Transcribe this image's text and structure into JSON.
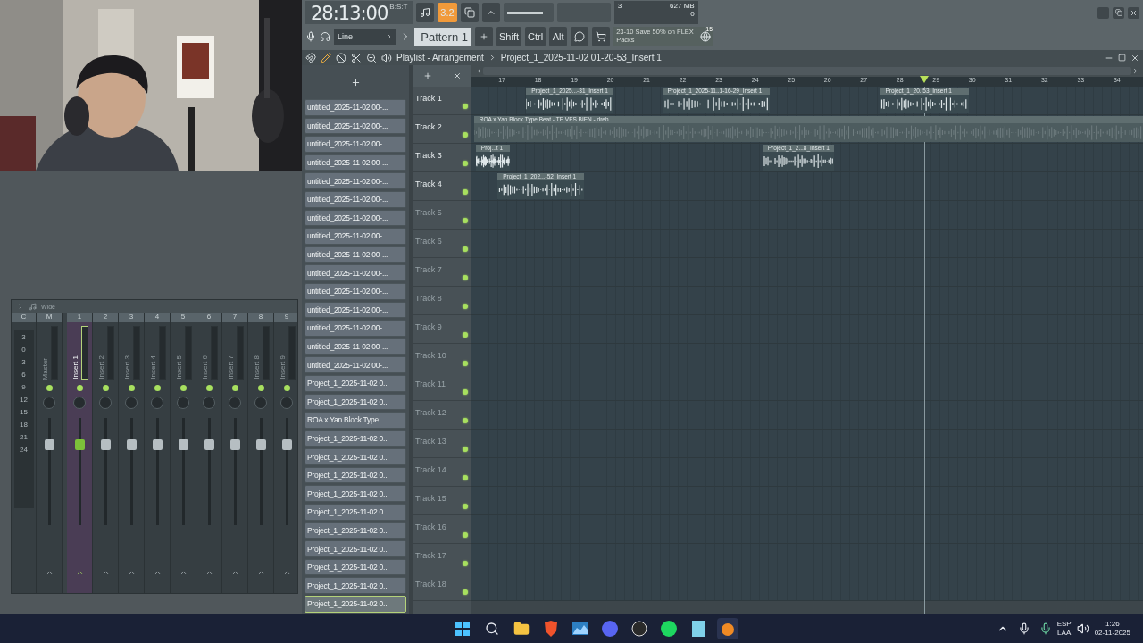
{
  "toolbar": {
    "time": "28:13:00",
    "time_format": "B:S:T",
    "snap": "3.2",
    "main_volume": {
      "level": 0.85
    },
    "cpu": "3",
    "memory": "627 MB",
    "polyphony": "0",
    "input": "Line",
    "pattern": "Pattern 1",
    "modifier_keys": [
      "Shift",
      "Ctrl",
      "Alt"
    ],
    "news": {
      "date": "23-10",
      "text": "Save 50% on FLEX Packs",
      "badge": "15"
    }
  },
  "playlist": {
    "title": "Playlist - Arrangement",
    "project": "Project_1_2025-11-02 01-20-53_Insert 1",
    "bars": [
      "17",
      "18",
      "19",
      "20",
      "21",
      "22",
      "23",
      "24",
      "25",
      "26",
      "27",
      "28",
      "29",
      "30",
      "31",
      "32",
      "33",
      "34"
    ],
    "clips": [
      {
        "label": "untitled_2025-11-02 00-...",
        "selected": false
      },
      {
        "label": "untitled_2025-11-02 00-...",
        "selected": false
      },
      {
        "label": "untitled_2025-11-02 00-...",
        "selected": false
      },
      {
        "label": "untitled_2025-11-02 00-...",
        "selected": false
      },
      {
        "label": "untitled_2025-11-02 00-...",
        "selected": false
      },
      {
        "label": "untitled_2025-11-02 00-...",
        "selected": false
      },
      {
        "label": "untitled_2025-11-02 00-...",
        "selected": false
      },
      {
        "label": "untitled_2025-11-02 00-...",
        "selected": false
      },
      {
        "label": "untitled_2025-11-02 00-...",
        "selected": false
      },
      {
        "label": "untitled_2025-11-02 00-...",
        "selected": false
      },
      {
        "label": "untitled_2025-11-02 00-...",
        "selected": false
      },
      {
        "label": "untitled_2025-11-02 00-...",
        "selected": false
      },
      {
        "label": "untitled_2025-11-02 00-...",
        "selected": false
      },
      {
        "label": "untitled_2025-11-02 00-...",
        "selected": false
      },
      {
        "label": "untitled_2025-11-02 00-...",
        "selected": false
      },
      {
        "label": "Project_1_2025-11-02 0...",
        "selected": false
      },
      {
        "label": "Project_1_2025-11-02 0...",
        "selected": false
      },
      {
        "label": "ROA x Yan Block Type..",
        "selected": false
      },
      {
        "label": "Project_1_2025-11-02 0...",
        "selected": false
      },
      {
        "label": "Project_1_2025-11-02 0...",
        "selected": false
      },
      {
        "label": "Project_1_2025-11-02 0...",
        "selected": false
      },
      {
        "label": "Project_1_2025-11-02 0...",
        "selected": false
      },
      {
        "label": "Project_1_2025-11-02 0...",
        "selected": false
      },
      {
        "label": "Project_1_2025-11-02 0...",
        "selected": false
      },
      {
        "label": "Project_1_2025-11-02 0...",
        "selected": false
      },
      {
        "label": "Project_1_2025-11-02 0...",
        "selected": false
      },
      {
        "label": "Project_1_2025-11-02 0...",
        "selected": false
      },
      {
        "label": "Project_1_2025-11-02 0...",
        "selected": true
      }
    ],
    "tracks": [
      {
        "name": "Track 1",
        "active": true,
        "clips": [
          {
            "label": "Project_1_2025...-31_Insert 1"
          },
          {
            "label": "Project_1_2025-11..1-16-29_Insert 1"
          },
          {
            "label": "Project_1_20..53_Insert 1"
          }
        ]
      },
      {
        "name": "Track 2",
        "active": true,
        "clips": [
          {
            "label": "ROA x Yan Block Type Beat - TE VES BIEN - dreh"
          }
        ]
      },
      {
        "name": "Track 3",
        "active": true,
        "clips": [
          {
            "label": "Proj...t 1"
          },
          {
            "label": "Project_1_2...8_Insert 1"
          }
        ]
      },
      {
        "name": "Track 4",
        "active": true,
        "clips": [
          {
            "label": "Project_1_202...-52_Insert 1"
          }
        ]
      },
      {
        "name": "Track 5",
        "active": false
      },
      {
        "name": "Track 6",
        "active": false
      },
      {
        "name": "Track 7",
        "active": false
      },
      {
        "name": "Track 8",
        "active": false
      },
      {
        "name": "Track 9",
        "active": false
      },
      {
        "name": "Track 10",
        "active": false
      },
      {
        "name": "Track 11",
        "active": false
      },
      {
        "name": "Track 12",
        "active": false
      },
      {
        "name": "Track 13",
        "active": false
      },
      {
        "name": "Track 14",
        "active": false
      },
      {
        "name": "Track 15",
        "active": false
      },
      {
        "name": "Track 16",
        "active": false
      },
      {
        "name": "Track 17",
        "active": false
      },
      {
        "name": "Track 18",
        "active": false
      }
    ]
  },
  "mixer": {
    "mode": "Wide",
    "scale": [
      "3",
      "0",
      "3",
      "6",
      "9",
      "12",
      "15",
      "18",
      "21",
      "24"
    ],
    "strips": [
      {
        "header": "M",
        "name": "Master",
        "selected": false,
        "level": 0.78
      },
      {
        "header": "1",
        "name": "Insert 1",
        "selected": true,
        "level": 0.78
      },
      {
        "header": "2",
        "name": "Insert 2",
        "selected": false,
        "level": 0.78
      },
      {
        "header": "3",
        "name": "Insert 3",
        "selected": false,
        "level": 0.78
      },
      {
        "header": "4",
        "name": "Insert 4",
        "selected": false,
        "level": 0.78
      },
      {
        "header": "5",
        "name": "Insert 5",
        "selected": false,
        "level": 0.78
      },
      {
        "header": "6",
        "name": "Insert 6",
        "selected": false,
        "level": 0.78
      },
      {
        "header": "7",
        "name": "Insert 7",
        "selected": false,
        "level": 0.78
      },
      {
        "header": "8",
        "name": "Insert 8",
        "selected": false,
        "level": 0.78
      },
      {
        "header": "9",
        "name": "Insert 9",
        "selected": false,
        "level": 0.78
      }
    ],
    "scale_header": "C"
  },
  "taskbar": {
    "language": "ESP",
    "layout": "LAA",
    "time": "1:26",
    "date": "02-11-2025"
  }
}
